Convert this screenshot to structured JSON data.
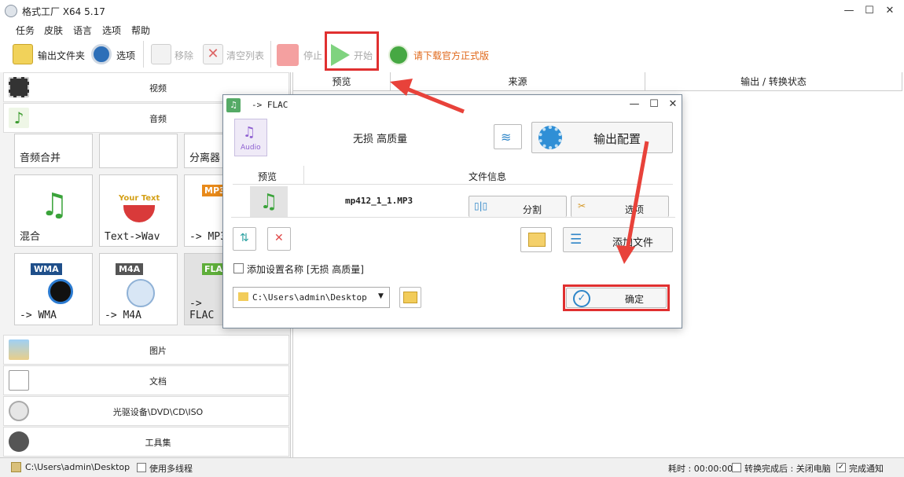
{
  "window": {
    "title": "格式工厂 X64 5.17",
    "minimize": "—",
    "maximize": "☐",
    "close": "✕"
  },
  "menu": [
    "任务",
    "皮肤",
    "语言",
    "选项",
    "帮助"
  ],
  "toolbar": {
    "output_folder": "输出文件夹",
    "options": "选项",
    "remove": "移除",
    "clear_list": "清空列表",
    "stop": "停止",
    "start": "开始",
    "download": "请下载官方正式版"
  },
  "categories": {
    "video": "视频",
    "audio": "音频",
    "picture": "图片",
    "document": "文档",
    "rom": "光驱设备\\DVD\\CD\\ISO",
    "tools": "工具集"
  },
  "tiles": {
    "row0": [
      "音频合并",
      "",
      "分离器"
    ],
    "row1": [
      "混合",
      "Text->Wav",
      "-> MP3"
    ],
    "row2": [
      "-> WMA",
      "-> M4A",
      "-> FLAC"
    ],
    "text_logo": "Your Text",
    "badges": {
      "mp3": "MP3",
      "wma": "WMA",
      "m4a": "M4A",
      "flac": "FLAC"
    }
  },
  "filelist": {
    "col_preview": "预览",
    "col_source": "来源",
    "col_status": "输出 / 转换状态"
  },
  "dialog": {
    "title": "-> FLAC",
    "audio_badge": "Audio",
    "quality": "无损 高质量",
    "output_config": "输出配置",
    "col_preview": "预览",
    "col_fileinfo": "文件信息",
    "filename": "mp412_1_1.MP3",
    "split": "分割",
    "options": "选项",
    "add_file": "添加文件",
    "add_setting_name": "添加设置名称 [无损 高质量]",
    "path": "C:\\Users\\admin\\Desktop",
    "ok": "确定"
  },
  "statusbar": {
    "path": "C:\\Users\\admin\\Desktop",
    "multithread": "使用多线程",
    "elapsed": "耗时 : 00:00:00",
    "after_convert": "转换完成后 : 关闭电脑",
    "notify": "完成通知"
  },
  "colors": {
    "accent_red": "#e03030",
    "start_green": "#7fd37f",
    "stop_red": "#f4a0a0"
  }
}
